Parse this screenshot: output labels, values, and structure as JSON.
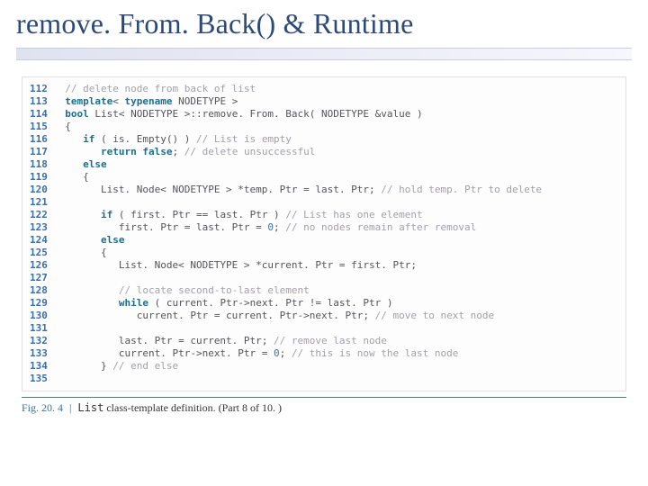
{
  "title": "remove. From. Back() & Runtime",
  "code": {
    "lines": [
      {
        "n": "112",
        "segs": [
          {
            "c": "cm",
            "t": "// delete node from back of list"
          }
        ]
      },
      {
        "n": "113",
        "segs": [
          {
            "c": "kw",
            "t": "template"
          },
          {
            "c": "tx",
            "t": "< "
          },
          {
            "c": "kw",
            "t": "typename"
          },
          {
            "c": "tx",
            "t": " NODETYPE >"
          }
        ]
      },
      {
        "n": "114",
        "segs": [
          {
            "c": "kw",
            "t": "bool"
          },
          {
            "c": "tx",
            "t": " List< NODETYPE >::remove. From. Back( NODETYPE &value )"
          }
        ]
      },
      {
        "n": "115",
        "segs": [
          {
            "c": "tx",
            "t": "{"
          }
        ]
      },
      {
        "n": "116",
        "segs": [
          {
            "c": "tx",
            "t": "   "
          },
          {
            "c": "kw",
            "t": "if"
          },
          {
            "c": "tx",
            "t": " ( is. Empty() ) "
          },
          {
            "c": "cm",
            "t": "// List is empty"
          }
        ]
      },
      {
        "n": "117",
        "segs": [
          {
            "c": "tx",
            "t": "      "
          },
          {
            "c": "kw",
            "t": "return false"
          },
          {
            "c": "tx",
            "t": "; "
          },
          {
            "c": "cm",
            "t": "// delete unsuccessful"
          }
        ]
      },
      {
        "n": "118",
        "segs": [
          {
            "c": "tx",
            "t": "   "
          },
          {
            "c": "kw",
            "t": "else"
          }
        ]
      },
      {
        "n": "119",
        "segs": [
          {
            "c": "tx",
            "t": "   {"
          }
        ]
      },
      {
        "n": "120",
        "segs": [
          {
            "c": "tx",
            "t": "      List. Node< NODETYPE > *temp. Ptr = last. Ptr; "
          },
          {
            "c": "cm",
            "t": "// hold temp. Ptr to delete"
          }
        ]
      },
      {
        "n": "121",
        "segs": []
      },
      {
        "n": "122",
        "segs": [
          {
            "c": "tx",
            "t": "      "
          },
          {
            "c": "kw",
            "t": "if"
          },
          {
            "c": "tx",
            "t": " ( first. Ptr == last. Ptr ) "
          },
          {
            "c": "cm",
            "t": "// List has one element"
          }
        ]
      },
      {
        "n": "123",
        "segs": [
          {
            "c": "tx",
            "t": "         first. Ptr = last. Ptr = "
          },
          {
            "c": "num",
            "t": "0"
          },
          {
            "c": "tx",
            "t": "; "
          },
          {
            "c": "cm",
            "t": "// no nodes remain after removal"
          }
        ]
      },
      {
        "n": "124",
        "segs": [
          {
            "c": "tx",
            "t": "      "
          },
          {
            "c": "kw",
            "t": "else"
          }
        ]
      },
      {
        "n": "125",
        "segs": [
          {
            "c": "tx",
            "t": "      {"
          }
        ]
      },
      {
        "n": "126",
        "segs": [
          {
            "c": "tx",
            "t": "         List. Node< NODETYPE > *current. Ptr = first. Ptr;"
          }
        ]
      },
      {
        "n": "127",
        "segs": []
      },
      {
        "n": "128",
        "segs": [
          {
            "c": "tx",
            "t": "         "
          },
          {
            "c": "cm",
            "t": "// locate second-to-last element"
          }
        ]
      },
      {
        "n": "129",
        "segs": [
          {
            "c": "tx",
            "t": "         "
          },
          {
            "c": "kw",
            "t": "while"
          },
          {
            "c": "tx",
            "t": " ( current. Ptr->next. Ptr != last. Ptr )"
          }
        ]
      },
      {
        "n": "130",
        "segs": [
          {
            "c": "tx",
            "t": "            current. Ptr = current. Ptr->next. Ptr; "
          },
          {
            "c": "cm",
            "t": "// move to next node"
          }
        ]
      },
      {
        "n": "131",
        "segs": []
      },
      {
        "n": "132",
        "segs": [
          {
            "c": "tx",
            "t": "         last. Ptr = current. Ptr; "
          },
          {
            "c": "cm",
            "t": "// remove last node"
          }
        ]
      },
      {
        "n": "133",
        "segs": [
          {
            "c": "tx",
            "t": "         current. Ptr->next. Ptr = "
          },
          {
            "c": "num",
            "t": "0"
          },
          {
            "c": "tx",
            "t": "; "
          },
          {
            "c": "cm",
            "t": "// this is now the last node"
          }
        ]
      },
      {
        "n": "134",
        "segs": [
          {
            "c": "tx",
            "t": "      } "
          },
          {
            "c": "cm",
            "t": "// end else"
          }
        ]
      },
      {
        "n": "135",
        "segs": []
      }
    ]
  },
  "figcap": {
    "fignum": "Fig. 20. 4",
    "pipe": "|",
    "listclass": "List",
    "desc": " class-template definition.",
    "part": " (Part 8 of 10. )"
  }
}
